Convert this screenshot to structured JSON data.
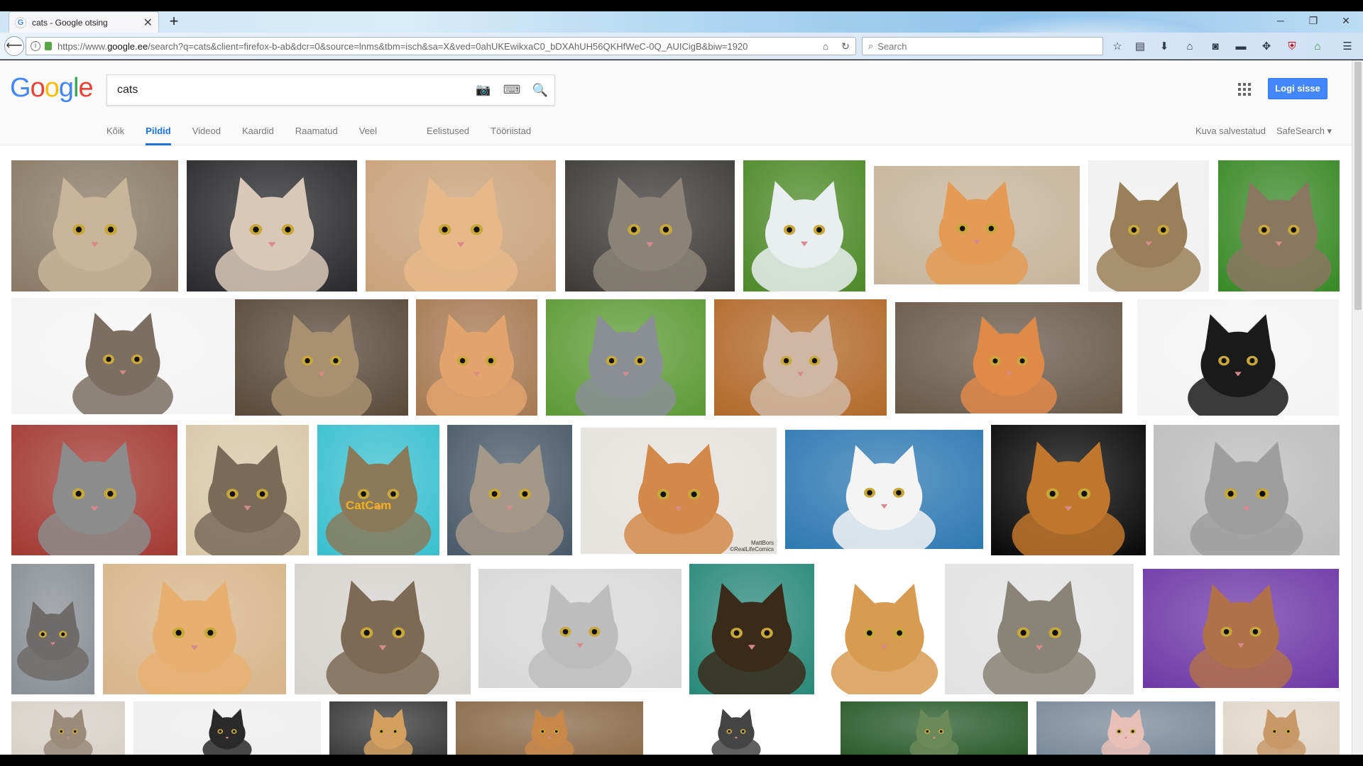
{
  "browser": {
    "tab_title": "cats - Google otsing",
    "tab_favicon": "G",
    "url_prefix": "https://www.",
    "url_host": "google.ee",
    "url_rest": "/search?q=cats&client=firefox-b-ab&dcr=0&source=lnms&tbm=isch&sa=X&ved=0ahUKEwikxaC0_bDXAhUH56QKHfWeC-0Q_AUICigB&biw=1920",
    "search_placeholder": "Search"
  },
  "google": {
    "logo_letters": [
      "G",
      "o",
      "o",
      "g",
      "l",
      "e"
    ],
    "logo_colors": [
      "#4285f4",
      "#ea4335",
      "#fbbc05",
      "#4285f4",
      "#34a853",
      "#ea4335"
    ],
    "query": "cats",
    "signin_label": "Logi sisse",
    "tabs": [
      "Kõik",
      "Pildid",
      "Videod",
      "Kaardid",
      "Raamatud",
      "Veel"
    ],
    "selected_tab": "Pildid",
    "extra_tabs": [
      "Eelistused",
      "Tööriistad"
    ],
    "saved_label": "Kuva salvestatud",
    "safesearch_label": "SafeSearch"
  },
  "results": {
    "image_overlay_text": [
      "CatCam",
      "MattBors\n©RealLifeComics"
    ]
  },
  "colors": {
    "accent_blue": "#1a73e8",
    "signin_blue": "#4387fd"
  }
}
